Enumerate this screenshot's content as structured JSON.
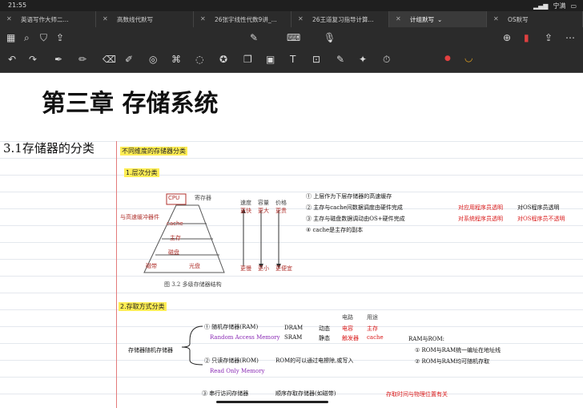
{
  "status_bar": {
    "time": "21:55",
    "network": "宁满"
  },
  "tabs": [
    {
      "label": "英语写作大师二...",
      "active": false
    },
    {
      "label": "高数线代默写",
      "active": false
    },
    {
      "label": "26张宇线性代数9讲_...",
      "active": false
    },
    {
      "label": "26王道复习指导计算...",
      "active": false
    },
    {
      "label": "计组默写",
      "active": true
    },
    {
      "label": "OS默写",
      "active": false
    }
  ],
  "note": {
    "chapter_title": "第三章 存储系统",
    "section_title": "3.1存储器的分类",
    "subtitle": "不同维度的存储器分类",
    "point1": "1.层次分类",
    "figure": {
      "caption": "图 3.2    多级存储器结构",
      "register_label": "寄存器",
      "levels": [
        "CPU",
        "cache",
        "主存",
        "磁盘",
        "磁带",
        "光盘"
      ],
      "speed": "速度",
      "capacity": "容量",
      "price": "价格",
      "fast": "更快",
      "big": "更大",
      "expensive": "更贵",
      "slower": "更慢",
      "smaller": "更小",
      "cheaper": "更便宜",
      "purple_note": "与高速缓冲器件"
    },
    "notes": [
      "① 上层作为下层存储器的高速缓存",
      "② 主存与cache间数据调度由硬件完成",
      "③ 主存与磁盘数据调动由OS+硬件完成"
    ],
    "notes_side": [
      "对应用程序员透明",
      "对系统程序员透明"
    ],
    "notes_side2": [
      "对OS程序员透明",
      "对OS程序员不透明"
    ],
    "note4": "④ cache是主存的副本",
    "point2": "2.存取方式分类",
    "labels_top": [
      "电路",
      "用途"
    ],
    "ram": {
      "title": "① 随机存储器(RAM)",
      "subtitle": "Random Access Memory",
      "dram": "DRAM",
      "sram": "SRAM",
      "dram_type": "动态",
      "sram_type": "静态",
      "dram_circuit": "电容",
      "sram_circuit": "触发器",
      "dram_use": "主存",
      "sram_use": "cache"
    },
    "random_access": "存储器随机存储器",
    "rom": {
      "title": "② 只读存储器(ROM)",
      "subtitle": "Read Only Memory",
      "desc": "ROM的可以通过电擦除,或写入"
    },
    "ram_rom": {
      "title": "RAM与ROM:",
      "line1": "① ROM与RAM统一编址在地址线",
      "line2": "② ROM与RAM均可随机存取"
    },
    "seq": {
      "title": "③ 串行访问存储器",
      "desc": "顺序存取存储器(如磁带)",
      "note": "存取时间与物理位置有关"
    }
  }
}
